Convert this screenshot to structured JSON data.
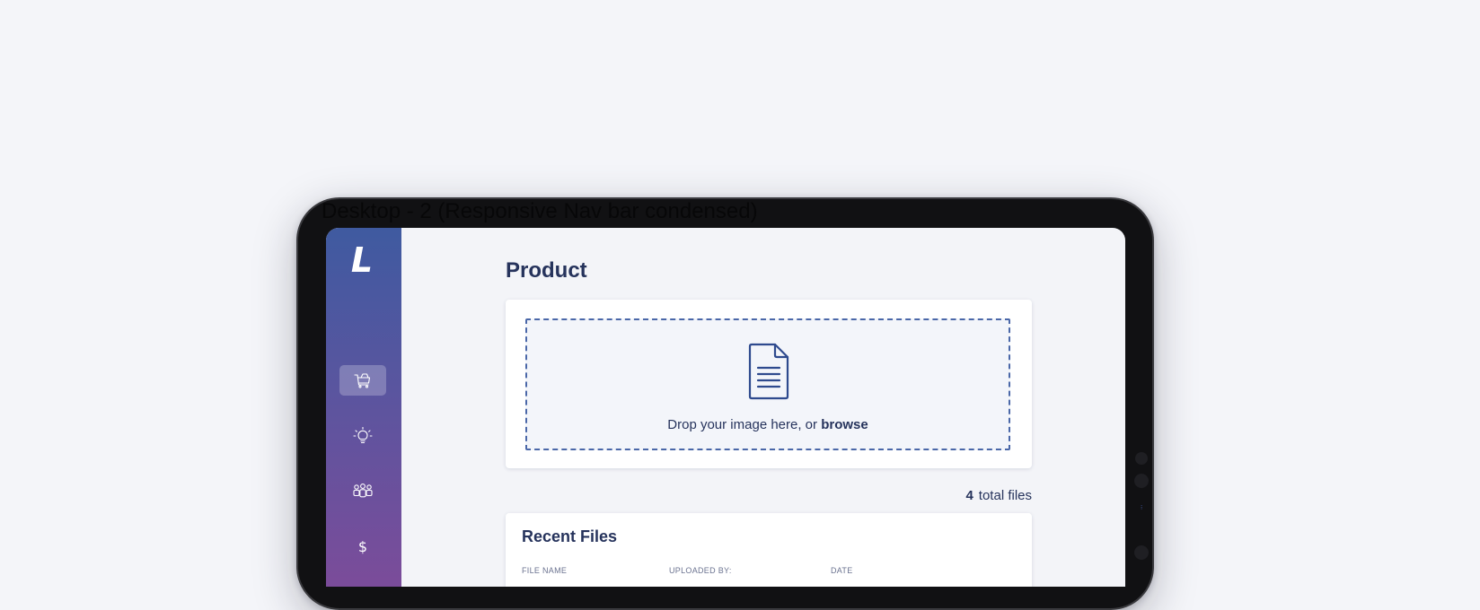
{
  "frame": {
    "label": "Desktop - 2 (Responsive Nav bar condensed)"
  },
  "sidebar": {
    "logo": "L",
    "items": [
      {
        "name": "shop",
        "icon": "basket-icon",
        "active": true
      },
      {
        "name": "ideas",
        "icon": "lightbulb-icon",
        "active": false
      },
      {
        "name": "team",
        "icon": "people-icon",
        "active": false
      },
      {
        "name": "pricing",
        "icon": "dollar-icon",
        "glyph": "$",
        "active": false
      }
    ]
  },
  "main": {
    "title": "Product",
    "upload": {
      "icon": "document-icon",
      "prompt": "Drop your image here, or",
      "browse": "browse"
    },
    "total_files": {
      "count": "4",
      "label": "total files"
    },
    "recent_files": {
      "title": "Recent Files",
      "columns": [
        "FILE NAME",
        "UPLOADED BY:",
        "DATE"
      ]
    }
  },
  "colors": {
    "accent": "#4a67a8",
    "text_dark": "#26335c",
    "sidebar_top": "#3f5aa0",
    "sidebar_bottom": "#7b4c9a",
    "page_bg": "#f4f5f9"
  }
}
